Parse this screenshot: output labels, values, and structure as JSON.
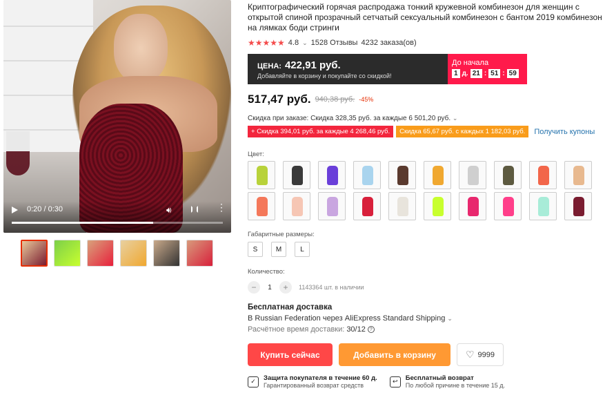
{
  "video": {
    "time": "0:20 / 0:30",
    "progress": 0.67
  },
  "product": {
    "title": "Криптографический горячая распродажа тонкий кружевной комбинезон для женщин с открытой спиной прозрачный сетчатый сексуальный комбинезон с бантом 2019 комбинезон на лямках боди стринги",
    "stars": "★★★★★",
    "rating": "4.8",
    "reviews": "1528 Отзывы",
    "orders": "4232 заказа(ов)"
  },
  "promo": {
    "label": "ЦЕНА:",
    "price": "422,91 руб.",
    "sub": "Добавляйте в корзину и покупайте со скидкой!",
    "countdown_label": "До начала",
    "days": "1",
    "days_unit": "д.",
    "hours": "21",
    "minutes": "51",
    "seconds": "59"
  },
  "price": {
    "current": "517,47 руб.",
    "old": "940,38 руб.",
    "discount": "-45%"
  },
  "discounts": {
    "order": "Скидка при заказе: Скидка 328,35 руб. за каждые 6 501,20 руб.",
    "coupon1": "Скидка 394,01 руб. за каждые 4 268,46 руб.",
    "coupon2": "Скидка 65,67 руб. с каждых 1 182,03 руб.",
    "get_coupons": "Получить купоны"
  },
  "color_label": "Цвет:",
  "swatch_colors": [
    "#b8d23a",
    "#3a3a3a",
    "#6a3fd9",
    "#a9d4ee",
    "#5a3a2e",
    "#f0a830",
    "#cfcfcf",
    "#5d5a40",
    "#f2664a",
    "#e8b98f",
    "#f4785a",
    "#f6c6b4",
    "#c9a6e0",
    "#d8203b",
    "#e8e4dc",
    "#c8ff2e",
    "#e8286e",
    "#ff3f8a",
    "#a8ecd8",
    "#7a1c30"
  ],
  "size_label": "Габаритные размеры:",
  "sizes": [
    "S",
    "M",
    "L"
  ],
  "qty_label": "Количество:",
  "qty": {
    "minus": "−",
    "value": "1",
    "plus": "+",
    "stock": "1143364 шт. в наличии"
  },
  "shipping": {
    "title": "Бесплатная доставка",
    "route": "В Russian Federation через AliExpress Standard Shipping",
    "time_label": "Расчётное время доставки:",
    "time_value": "30/12"
  },
  "actions": {
    "buy": "Купить сейчас",
    "cart": "Добавить в корзину",
    "wishlist_count": "9999"
  },
  "guarantees": [
    {
      "title": "Защита покупателя в течение 60 д.",
      "sub": "Гарантированный возврат средств"
    },
    {
      "title": "Бесплатный возврат",
      "sub": "По любой причине в течение 15 д."
    }
  ]
}
